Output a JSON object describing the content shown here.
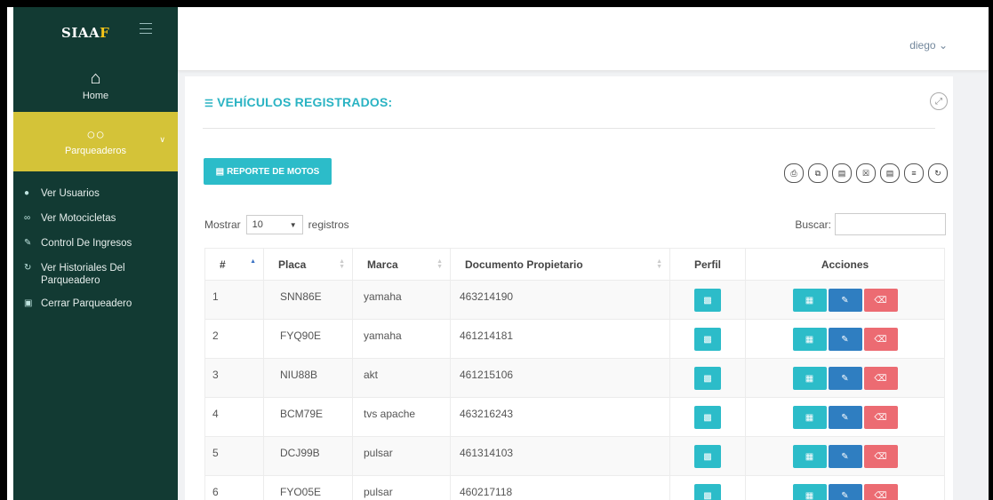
{
  "sidebar": {
    "brand_main": "SIAA",
    "brand_accent": "F",
    "home": {
      "icon": "home-icon",
      "label": "Home"
    },
    "parqueaderos": {
      "icon": "motorcycle-icon",
      "label": "Parqueaderos"
    },
    "items": [
      {
        "icon": "user-icon",
        "label": "Ver Usuarios"
      },
      {
        "icon": "motorcycle-icon",
        "label": "Ver Motocicletas"
      },
      {
        "icon": "edit-icon",
        "label": "Control De Ingresos"
      },
      {
        "icon": "history-icon",
        "label": "Ver Historiales Del Parqueadero"
      },
      {
        "icon": "close-box-icon",
        "label": "Cerrar Parqueadero"
      }
    ]
  },
  "topbar": {
    "user": "diego"
  },
  "panel": {
    "title": "VEHÍCULOS REGISTRADOS:",
    "report_button": "REPORTE DE MOTOS",
    "export_buttons": [
      "print-icon",
      "copy-icon",
      "pdf-icon",
      "excel-icon",
      "csv-icon",
      "columns-icon",
      "refresh-icon"
    ],
    "show_label": "Mostrar",
    "length_value": "10",
    "records_label": "registros",
    "search_label": "Buscar:",
    "search_value": ""
  },
  "table": {
    "columns": [
      "#",
      "Placa",
      "Marca",
      "Documento Propietario",
      "Perfil",
      "Acciones"
    ],
    "rows": [
      {
        "n": "1",
        "placa": "SNN86E",
        "marca": "yamaha",
        "doc": "463214190"
      },
      {
        "n": "2",
        "placa": "FYQ90E",
        "marca": "yamaha",
        "doc": "461214181"
      },
      {
        "n": "3",
        "placa": "NIU88B",
        "marca": "akt",
        "doc": "461215106"
      },
      {
        "n": "4",
        "placa": "BCM79E",
        "marca": "tvs apache",
        "doc": "463216243"
      },
      {
        "n": "5",
        "placa": "DCJ99B",
        "marca": "pulsar",
        "doc": "461314103"
      },
      {
        "n": "6",
        "placa": "FYO05E",
        "marca": "pulsar",
        "doc": "460217118"
      }
    ]
  },
  "colors": {
    "sidebar": "#123a33",
    "active": "#d4c338",
    "teal": "#2cbcc9",
    "blue": "#2f7ec1",
    "red": "#ec6b72"
  }
}
